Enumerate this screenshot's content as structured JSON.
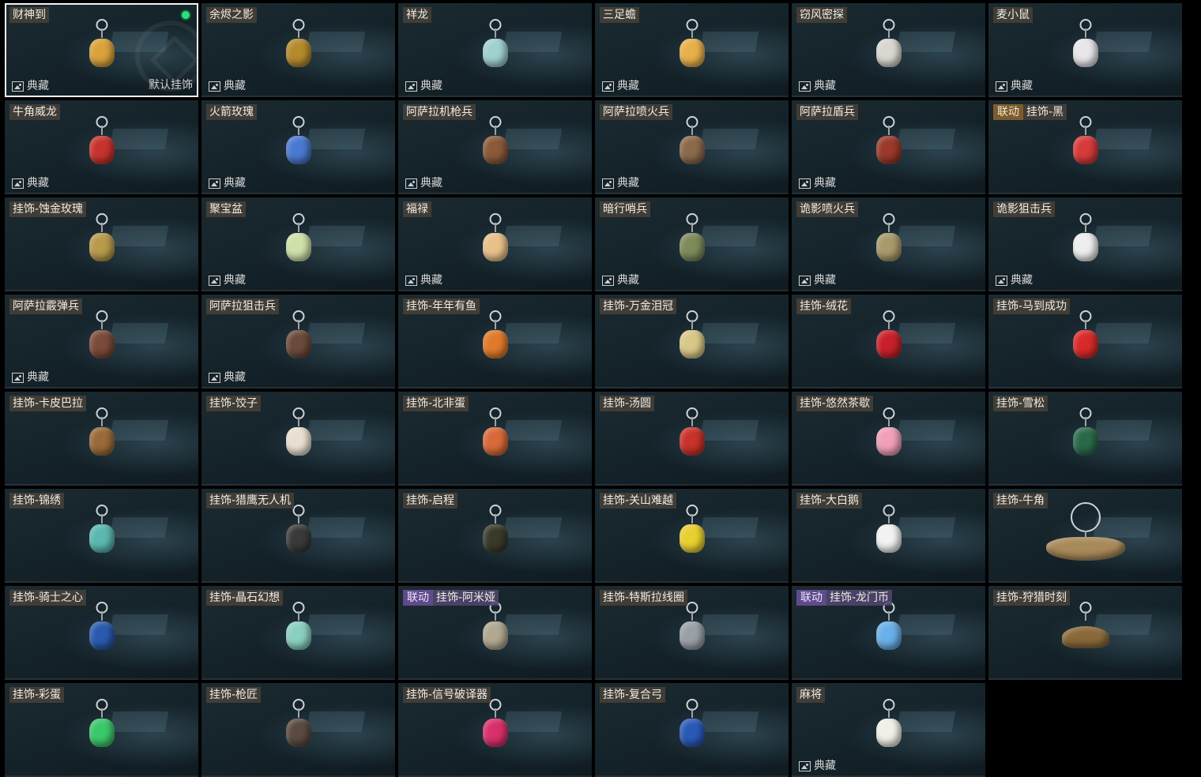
{
  "labels": {
    "favorite": "典藏",
    "default": "默认挂饰"
  },
  "colors": {
    "selected_dot": "#2ee07a",
    "collab_tag": "#7c5c2e",
    "collab_tag_purple": "#5f4a8a"
  },
  "items": [
    {
      "name": "财神到",
      "fav": true,
      "selected": true,
      "default": true,
      "equipped": true,
      "icon": "god-of-wealth-pendant-icon",
      "color": "#d9a23b"
    },
    {
      "name": "余烬之影",
      "fav": true,
      "icon": "ember-shadow-pendant-icon",
      "color": "#b58a2c"
    },
    {
      "name": "祥龙",
      "fav": true,
      "icon": "dragon-pendant-icon",
      "color": "#9fd1d1"
    },
    {
      "name": "三足蟾",
      "fav": true,
      "icon": "three-legged-toad-pendant-icon",
      "color": "#e8b04a"
    },
    {
      "name": "窃风密探",
      "fav": true,
      "icon": "wind-spy-pendant-icon",
      "color": "#d8d8d0"
    },
    {
      "name": "麦小鼠",
      "fav": true,
      "icon": "mouse-pendant-icon",
      "color": "#e9e6ea"
    },
    {
      "name": "牛角威龙",
      "fav": true,
      "icon": "horned-dragon-pendant-icon",
      "color": "#c8322d"
    },
    {
      "name": "火箭玫瑰",
      "fav": true,
      "icon": "rocket-rose-pendant-icon",
      "color": "#4a7ad0"
    },
    {
      "name": "阿萨拉机枪兵",
      "fav": true,
      "icon": "asala-gunner-pendant-icon",
      "color": "#8a5a3a"
    },
    {
      "name": "阿萨拉喷火兵",
      "fav": true,
      "icon": "asala-flamethrower-pendant-icon",
      "color": "#8a6a4a"
    },
    {
      "name": "阿萨拉盾兵",
      "fav": true,
      "icon": "asala-shield-pendant-icon",
      "color": "#9a3a2a"
    },
    {
      "name": "挂饰-黑",
      "collab": "联动",
      "icon": "black-card-pendant-icon",
      "color": "#d83a3a"
    },
    {
      "name": "挂饰-蚀金玫瑰",
      "icon": "gold-rose-pendant-icon",
      "color": "#b89a4a"
    },
    {
      "name": "聚宝盆",
      "fav": true,
      "icon": "treasure-bowl-pendant-icon",
      "color": "#cfe0a8"
    },
    {
      "name": "福禄",
      "fav": true,
      "icon": "gourd-pendant-icon",
      "color": "#e8c08a"
    },
    {
      "name": "暗行哨兵",
      "fav": true,
      "icon": "shadow-sentry-pendant-icon",
      "color": "#7d8a5a"
    },
    {
      "name": "诡影喷火兵",
      "fav": true,
      "icon": "ghost-flamethrower-pendant-icon",
      "color": "#a89a6a"
    },
    {
      "name": "诡影狙击兵",
      "fav": true,
      "icon": "ghost-sniper-pendant-icon",
      "color": "#eeeeee"
    },
    {
      "name": "阿萨拉霰弹兵",
      "fav": true,
      "icon": "asala-shotgunner-pendant-icon",
      "color": "#7a4a3a"
    },
    {
      "name": "阿萨拉狙击兵",
      "fav": true,
      "icon": "asala-sniper-pendant-icon",
      "color": "#6a4a3a"
    },
    {
      "name": "挂饰-年年有鱼",
      "icon": "fish-pendant-icon",
      "color": "#e07a2a"
    },
    {
      "name": "挂饰-万金泪冠",
      "icon": "crown-pendant-icon",
      "color": "#d8c888"
    },
    {
      "name": "挂饰-绒花",
      "icon": "velvet-flower-pendant-icon",
      "color": "#c8202a"
    },
    {
      "name": "挂饰-马到成功",
      "icon": "horse-pendant-icon",
      "color": "#d82a2a"
    },
    {
      "name": "挂饰-卡皮巴拉",
      "icon": "capybara-pendant-icon",
      "color": "#9a6a3a"
    },
    {
      "name": "挂饰-饺子",
      "icon": "dumpling-pendant-icon",
      "color": "#e8e0d0"
    },
    {
      "name": "挂饰-北非蛋",
      "icon": "shakshuka-pendant-icon",
      "color": "#d86a3a"
    },
    {
      "name": "挂饰-汤圆",
      "icon": "tangyuan-pendant-icon",
      "color": "#c8322a"
    },
    {
      "name": "挂饰-悠然茶歇",
      "icon": "cupcake-pendant-icon",
      "color": "#f0a0b8"
    },
    {
      "name": "挂饰-雪松",
      "icon": "cedar-pendant-icon",
      "color": "#2a6a4a"
    },
    {
      "name": "挂饰-锦绣",
      "icon": "butterfly-pendant-icon",
      "color": "#5ab8b0"
    },
    {
      "name": "挂饰-猎鹰无人机",
      "icon": "falcon-drone-pendant-icon",
      "color": "#3a3a3a"
    },
    {
      "name": "挂饰-启程",
      "icon": "compass-pendant-icon",
      "color": "#3a3a2a"
    },
    {
      "name": "挂饰-关山难越",
      "icon": "gold-bar-pendant-icon",
      "color": "#e8d030"
    },
    {
      "name": "挂饰-大白鹅",
      "icon": "goose-pendant-icon",
      "color": "#f2f2f2"
    },
    {
      "name": "挂饰-牛角",
      "icon": "bull-horn-pendant-icon",
      "color": "#a88a5a",
      "wide": "big"
    },
    {
      "name": "挂饰-骑士之心",
      "icon": "knight-heart-pendant-icon",
      "color": "#2a5ab0"
    },
    {
      "name": "挂饰-晶石幻想",
      "icon": "crystal-cube-pendant-icon",
      "color": "#8ad0c0"
    },
    {
      "name": "挂饰-阿米娅",
      "collab": "联动",
      "purple": true,
      "icon": "amiya-pendant-icon",
      "color": "#b0a890"
    },
    {
      "name": "挂饰-特斯拉线圈",
      "icon": "tesla-coil-pendant-icon",
      "color": "#9aa0a8"
    },
    {
      "name": "挂饰-龙门币",
      "collab": "联动",
      "purple": true,
      "icon": "lungmen-coin-pendant-icon",
      "color": "#6ab0e8"
    },
    {
      "name": "挂饰-狩猎时刻",
      "icon": "moose-antler-pendant-icon",
      "color": "#8a6a3a",
      "wide": "wide"
    },
    {
      "name": "挂饰-彩蛋",
      "icon": "easter-egg-pendant-icon",
      "color": "#3ac86a"
    },
    {
      "name": "挂饰-枪匠",
      "icon": "gunsmith-pendant-icon",
      "color": "#5a4a40"
    },
    {
      "name": "挂饰-信号破译器",
      "icon": "signal-decoder-pendant-icon",
      "color": "#d8306a"
    },
    {
      "name": "挂饰-复合弓",
      "icon": "compound-bow-pendant-icon",
      "color": "#2a5ab8"
    },
    {
      "name": "麻将",
      "fav": true,
      "icon": "mahjong-pendant-icon",
      "color": "#f0f0e8"
    }
  ]
}
